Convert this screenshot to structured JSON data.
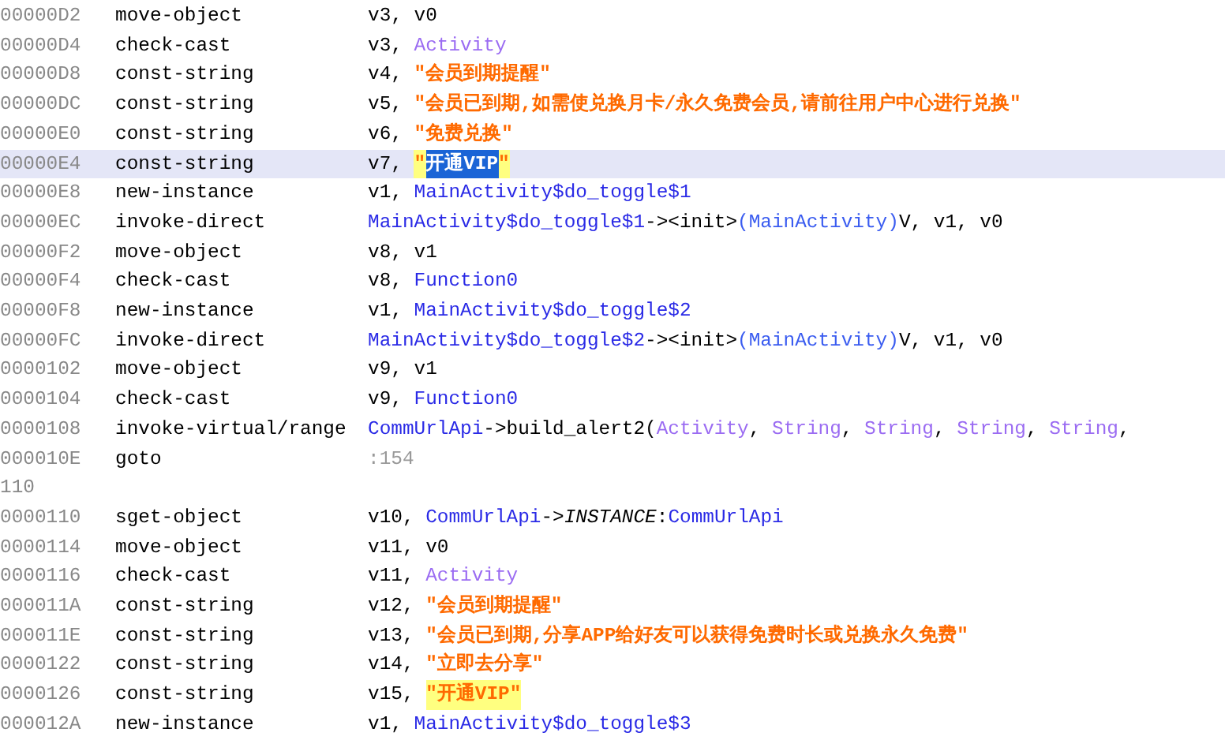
{
  "lines": [
    {
      "kind": "instruction",
      "address": "00000D2",
      "opcode": "move-object",
      "operands": [
        {
          "kind": "plain",
          "text": "v3, v0"
        }
      ],
      "selected": false
    },
    {
      "kind": "instruction",
      "address": "00000D4",
      "opcode": "check-cast",
      "operands": [
        {
          "kind": "plain",
          "text": "v3, "
        },
        {
          "kind": "type",
          "text": "Activity"
        }
      ],
      "selected": false
    },
    {
      "kind": "instruction",
      "address": "00000D8",
      "opcode": "const-string",
      "operands": [
        {
          "kind": "plain",
          "text": "v4, "
        },
        {
          "kind": "string",
          "text": "\"会员到期提醒\""
        }
      ],
      "selected": false
    },
    {
      "kind": "instruction",
      "address": "00000DC",
      "opcode": "const-string",
      "operands": [
        {
          "kind": "plain",
          "text": "v5, "
        },
        {
          "kind": "string",
          "text": "\"会员已到期,如需使兑换月卡/永久免费会员,请前往用户中心进行兑换\""
        }
      ],
      "selected": false
    },
    {
      "kind": "instruction",
      "address": "00000E0",
      "opcode": "const-string",
      "operands": [
        {
          "kind": "plain",
          "text": "v6, "
        },
        {
          "kind": "string",
          "text": "\"免费兑换\""
        }
      ],
      "selected": false
    },
    {
      "kind": "instruction",
      "address": "00000E4",
      "opcode": "const-string",
      "operands": [
        {
          "kind": "plain",
          "text": "v7, "
        },
        {
          "kind": "string",
          "text": "\"",
          "highlighted": true,
          "selected": false
        },
        {
          "kind": "string",
          "text": "开通VIP",
          "highlighted": true,
          "selected": true
        },
        {
          "kind": "string",
          "text": "\"",
          "highlighted": true,
          "selected": false
        }
      ],
      "selected": true
    },
    {
      "kind": "instruction",
      "address": "00000E8",
      "opcode": "new-instance",
      "operands": [
        {
          "kind": "plain",
          "text": "v1, "
        },
        {
          "kind": "class",
          "text": "MainActivity$do_toggle$1"
        }
      ],
      "selected": false
    },
    {
      "kind": "instruction",
      "address": "00000EC",
      "opcode": "invoke-direct",
      "operands": [
        {
          "kind": "class",
          "text": "MainActivity$do_toggle$1"
        },
        {
          "kind": "plain",
          "text": "-><init>"
        },
        {
          "kind": "ref",
          "text": "(MainActivity)"
        },
        {
          "kind": "plain",
          "text": "V, v1, v0"
        }
      ],
      "selected": false
    },
    {
      "kind": "instruction",
      "address": "00000F2",
      "opcode": "move-object",
      "operands": [
        {
          "kind": "plain",
          "text": "v8, v1"
        }
      ],
      "selected": false
    },
    {
      "kind": "instruction",
      "address": "00000F4",
      "opcode": "check-cast",
      "operands": [
        {
          "kind": "plain",
          "text": "v8, "
        },
        {
          "kind": "class",
          "text": "Function0"
        }
      ],
      "selected": false
    },
    {
      "kind": "instruction",
      "address": "00000F8",
      "opcode": "new-instance",
      "operands": [
        {
          "kind": "plain",
          "text": "v1, "
        },
        {
          "kind": "class",
          "text": "MainActivity$do_toggle$2"
        }
      ],
      "selected": false
    },
    {
      "kind": "instruction",
      "address": "00000FC",
      "opcode": "invoke-direct",
      "operands": [
        {
          "kind": "class",
          "text": "MainActivity$do_toggle$2"
        },
        {
          "kind": "plain",
          "text": "-><init>"
        },
        {
          "kind": "ref",
          "text": "(MainActivity)"
        },
        {
          "kind": "plain",
          "text": "V, v1, v0"
        }
      ],
      "selected": false
    },
    {
      "kind": "instruction",
      "address": "0000102",
      "opcode": "move-object",
      "operands": [
        {
          "kind": "plain",
          "text": "v9, v1"
        }
      ],
      "selected": false
    },
    {
      "kind": "instruction",
      "address": "0000104",
      "opcode": "check-cast",
      "operands": [
        {
          "kind": "plain",
          "text": "v9, "
        },
        {
          "kind": "class",
          "text": "Function0"
        }
      ],
      "selected": false
    },
    {
      "kind": "instruction",
      "address": "0000108",
      "opcode": "invoke-virtual/range",
      "operands": [
        {
          "kind": "class",
          "text": "CommUrlApi"
        },
        {
          "kind": "plain",
          "text": "->build_alert2("
        },
        {
          "kind": "type",
          "text": "Activity"
        },
        {
          "kind": "plain",
          "text": ", "
        },
        {
          "kind": "type",
          "text": "String"
        },
        {
          "kind": "plain",
          "text": ", "
        },
        {
          "kind": "type",
          "text": "String"
        },
        {
          "kind": "plain",
          "text": ", "
        },
        {
          "kind": "type",
          "text": "String"
        },
        {
          "kind": "plain",
          "text": ", "
        },
        {
          "kind": "type",
          "text": "String"
        },
        {
          "kind": "plain",
          "text": ","
        }
      ],
      "selected": false
    },
    {
      "kind": "instruction",
      "address": "000010E",
      "opcode": "goto",
      "operands": [
        {
          "kind": "label",
          "text": ":154"
        }
      ],
      "selected": false
    },
    {
      "kind": "label",
      "address": "110",
      "selected": false
    },
    {
      "kind": "instruction",
      "address": "0000110",
      "opcode": "sget-object",
      "operands": [
        {
          "kind": "plain",
          "text": "v10, "
        },
        {
          "kind": "class",
          "text": "CommUrlApi"
        },
        {
          "kind": "plain",
          "text": "->"
        },
        {
          "kind": "italic",
          "text": "INSTANCE"
        },
        {
          "kind": "plain",
          "text": ":"
        },
        {
          "kind": "class",
          "text": "CommUrlApi"
        }
      ],
      "selected": false
    },
    {
      "kind": "instruction",
      "address": "0000114",
      "opcode": "move-object",
      "operands": [
        {
          "kind": "plain",
          "text": "v11, v0"
        }
      ],
      "selected": false
    },
    {
      "kind": "instruction",
      "address": "0000116",
      "opcode": "check-cast",
      "operands": [
        {
          "kind": "plain",
          "text": "v11, "
        },
        {
          "kind": "type",
          "text": "Activity"
        }
      ],
      "selected": false
    },
    {
      "kind": "instruction",
      "address": "000011A",
      "opcode": "const-string",
      "operands": [
        {
          "kind": "plain",
          "text": "v12, "
        },
        {
          "kind": "string",
          "text": "\"会员到期提醒\""
        }
      ],
      "selected": false
    },
    {
      "kind": "instruction",
      "address": "000011E",
      "opcode": "const-string",
      "operands": [
        {
          "kind": "plain",
          "text": "v13, "
        },
        {
          "kind": "string",
          "text": "\"会员已到期,分享APP给好友可以获得免费时长或兑换永久免费\""
        }
      ],
      "selected": false
    },
    {
      "kind": "instruction",
      "address": "0000122",
      "opcode": "const-string",
      "operands": [
        {
          "kind": "plain",
          "text": "v14, "
        },
        {
          "kind": "string",
          "text": "\"立即去分享\""
        }
      ],
      "selected": false
    },
    {
      "kind": "instruction",
      "address": "0000126",
      "opcode": "const-string",
      "operands": [
        {
          "kind": "plain",
          "text": "v15, "
        },
        {
          "kind": "string",
          "text": "\"开通VIP\"",
          "highlighted": true,
          "selected": false
        }
      ],
      "selected": false
    },
    {
      "kind": "instruction",
      "address": "000012A",
      "opcode": "new-instance",
      "operands": [
        {
          "kind": "plain",
          "text": "v1, "
        },
        {
          "kind": "class",
          "text": "MainActivity$do_toggle$3"
        }
      ],
      "selected": false
    }
  ]
}
